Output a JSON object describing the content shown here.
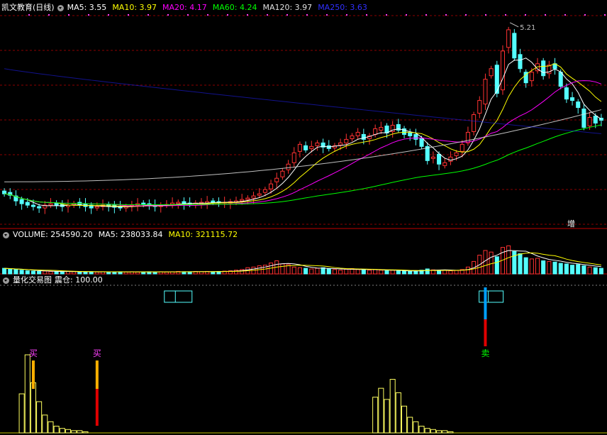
{
  "colors": {
    "bg": "#000000",
    "up": "#ff3232",
    "down": "#54ffff",
    "grid": "#8b0000",
    "ma5": "#ffffff",
    "ma10": "#ffff00",
    "ma20": "#ff00ff",
    "ma60": "#00ff00",
    "ma120": "#e0e0e0",
    "ma250": "#2020ff",
    "vol_ma5": "#ffffff",
    "vol_ma10": "#ffff00"
  },
  "header": {
    "title": "凯文教育(日线)",
    "ma5": "MA5: 3.55",
    "ma10": "MA10: 3.97",
    "ma20": "MA20: 4.17",
    "ma60": "MA60: 4.24",
    "ma120": "MA120: 3.97",
    "ma250": "MA250: 3.63"
  },
  "volume_header": {
    "volume": "VOLUME: 254590.20",
    "ma5": "MA5: 238033.84",
    "ma10": "MA10: 321115.72"
  },
  "indicator_header": {
    "name": "量化交易图",
    "value": "震仓: 100.00"
  },
  "chart_data": [
    {
      "type": "candlestick",
      "panel": "price",
      "peak_label": "5.21",
      "corner_label": "增",
      "closes": [
        2.78,
        2.76,
        2.68,
        2.64,
        2.62,
        2.6,
        2.58,
        2.62,
        2.64,
        2.62,
        2.6,
        2.62,
        2.64,
        2.63,
        2.6,
        2.58,
        2.6,
        2.62,
        2.6,
        2.59,
        2.58,
        2.6,
        2.62,
        2.64,
        2.63,
        2.61,
        2.6,
        2.62,
        2.63,
        2.65,
        2.66,
        2.64,
        2.63,
        2.65,
        2.66,
        2.67,
        2.66,
        2.65,
        2.66,
        2.67,
        2.68,
        2.7,
        2.72,
        2.75,
        2.78,
        2.84,
        2.92,
        3.0,
        3.1,
        3.2,
        3.36,
        3.48,
        3.4,
        3.45,
        3.5,
        3.44,
        3.42,
        3.46,
        3.5,
        3.55,
        3.6,
        3.65,
        3.55,
        3.6,
        3.7,
        3.72,
        3.64,
        3.75,
        3.68,
        3.62,
        3.6,
        3.55,
        3.45,
        3.25,
        3.3,
        3.2,
        3.22,
        3.3,
        3.36,
        3.48,
        3.65,
        3.9,
        4.1,
        4.4,
        4.55,
        4.2,
        4.8,
        5.1,
        4.7,
        4.55,
        4.35,
        4.5,
        4.62,
        4.45,
        4.6,
        4.55,
        4.3,
        4.12,
        4.1,
        4.0,
        3.72,
        3.86,
        3.78,
        3.82
      ],
      "opens": [
        2.82,
        2.8,
        2.75,
        2.7,
        2.66,
        2.62,
        2.6,
        2.58,
        2.62,
        2.65,
        2.63,
        2.6,
        2.62,
        2.66,
        2.64,
        2.62,
        2.58,
        2.6,
        2.63,
        2.62,
        2.6,
        2.58,
        2.6,
        2.62,
        2.65,
        2.64,
        2.62,
        2.6,
        2.62,
        2.63,
        2.64,
        2.67,
        2.65,
        2.63,
        2.64,
        2.65,
        2.68,
        2.67,
        2.65,
        2.65,
        2.66,
        2.68,
        2.7,
        2.72,
        2.76,
        2.8,
        2.85,
        2.95,
        3.02,
        3.12,
        3.22,
        3.38,
        3.46,
        3.42,
        3.46,
        3.5,
        3.46,
        3.43,
        3.47,
        3.5,
        3.56,
        3.6,
        3.62,
        3.56,
        3.62,
        3.68,
        3.74,
        3.66,
        3.76,
        3.7,
        3.64,
        3.62,
        3.56,
        3.45,
        3.28,
        3.34,
        3.18,
        3.24,
        3.32,
        3.38,
        3.5,
        3.66,
        3.92,
        4.05,
        4.45,
        4.6,
        4.25,
        4.85,
        5.05,
        4.75,
        4.5,
        4.38,
        4.52,
        4.66,
        4.48,
        4.62,
        4.5,
        4.28,
        4.14,
        4.08,
        3.98,
        3.74,
        3.88,
        3.85
      ],
      "ma_last": {
        "MA5": 3.55,
        "MA10": 3.97,
        "MA20": 4.17,
        "MA60": 4.24,
        "MA120": 3.97,
        "MA250": 3.63
      }
    },
    {
      "type": "bar",
      "panel": "volume",
      "ylim": [
        0,
        1.0
      ],
      "values": [
        0.18,
        0.16,
        0.14,
        0.12,
        0.1,
        0.09,
        0.08,
        0.09,
        0.08,
        0.07,
        0.07,
        0.08,
        0.07,
        0.07,
        0.06,
        0.07,
        0.06,
        0.07,
        0.06,
        0.06,
        0.07,
        0.06,
        0.07,
        0.06,
        0.06,
        0.07,
        0.06,
        0.07,
        0.06,
        0.07,
        0.08,
        0.07,
        0.07,
        0.08,
        0.07,
        0.08,
        0.07,
        0.08,
        0.09,
        0.1,
        0.12,
        0.14,
        0.2,
        0.22,
        0.26,
        0.28,
        0.35,
        0.42,
        0.32,
        0.3,
        0.22,
        0.2,
        0.18,
        0.16,
        0.18,
        0.2,
        0.16,
        0.14,
        0.12,
        0.15,
        0.17,
        0.14,
        0.13,
        0.12,
        0.14,
        0.12,
        0.1,
        0.12,
        0.1,
        0.09,
        0.08,
        0.1,
        0.12,
        0.16,
        0.13,
        0.12,
        0.12,
        0.1,
        0.11,
        0.14,
        0.22,
        0.4,
        0.6,
        0.75,
        0.7,
        0.55,
        0.85,
        0.9,
        0.72,
        0.65,
        0.52,
        0.48,
        0.5,
        0.42,
        0.4,
        0.38,
        0.34,
        0.32,
        0.28,
        0.3,
        0.26,
        0.22,
        0.2,
        0.18
      ]
    },
    {
      "type": "signal",
      "panel": "indicator",
      "signals": [
        {
          "label": "买",
          "index": 5,
          "kind": "buy"
        },
        {
          "label": "买",
          "index": 16,
          "kind": "buy"
        },
        {
          "label": "卖",
          "index": 83,
          "kind": "sell"
        }
      ],
      "histogram_series": [
        {
          "name": "",
          "start": 3,
          "values": [
            0.35,
            0.7,
            0.45,
            0.28,
            0.16,
            0.1,
            0.06,
            0.04,
            0.03,
            0.02,
            0.02,
            0.01
          ]
        },
        {
          "name": "",
          "start": 64,
          "values": [
            0.32,
            0.4,
            0.3,
            0.48,
            0.36,
            0.24,
            0.14,
            0.1,
            0.06,
            0.04,
            0.03,
            0.02,
            0.02,
            0.01
          ]
        }
      ]
    }
  ]
}
